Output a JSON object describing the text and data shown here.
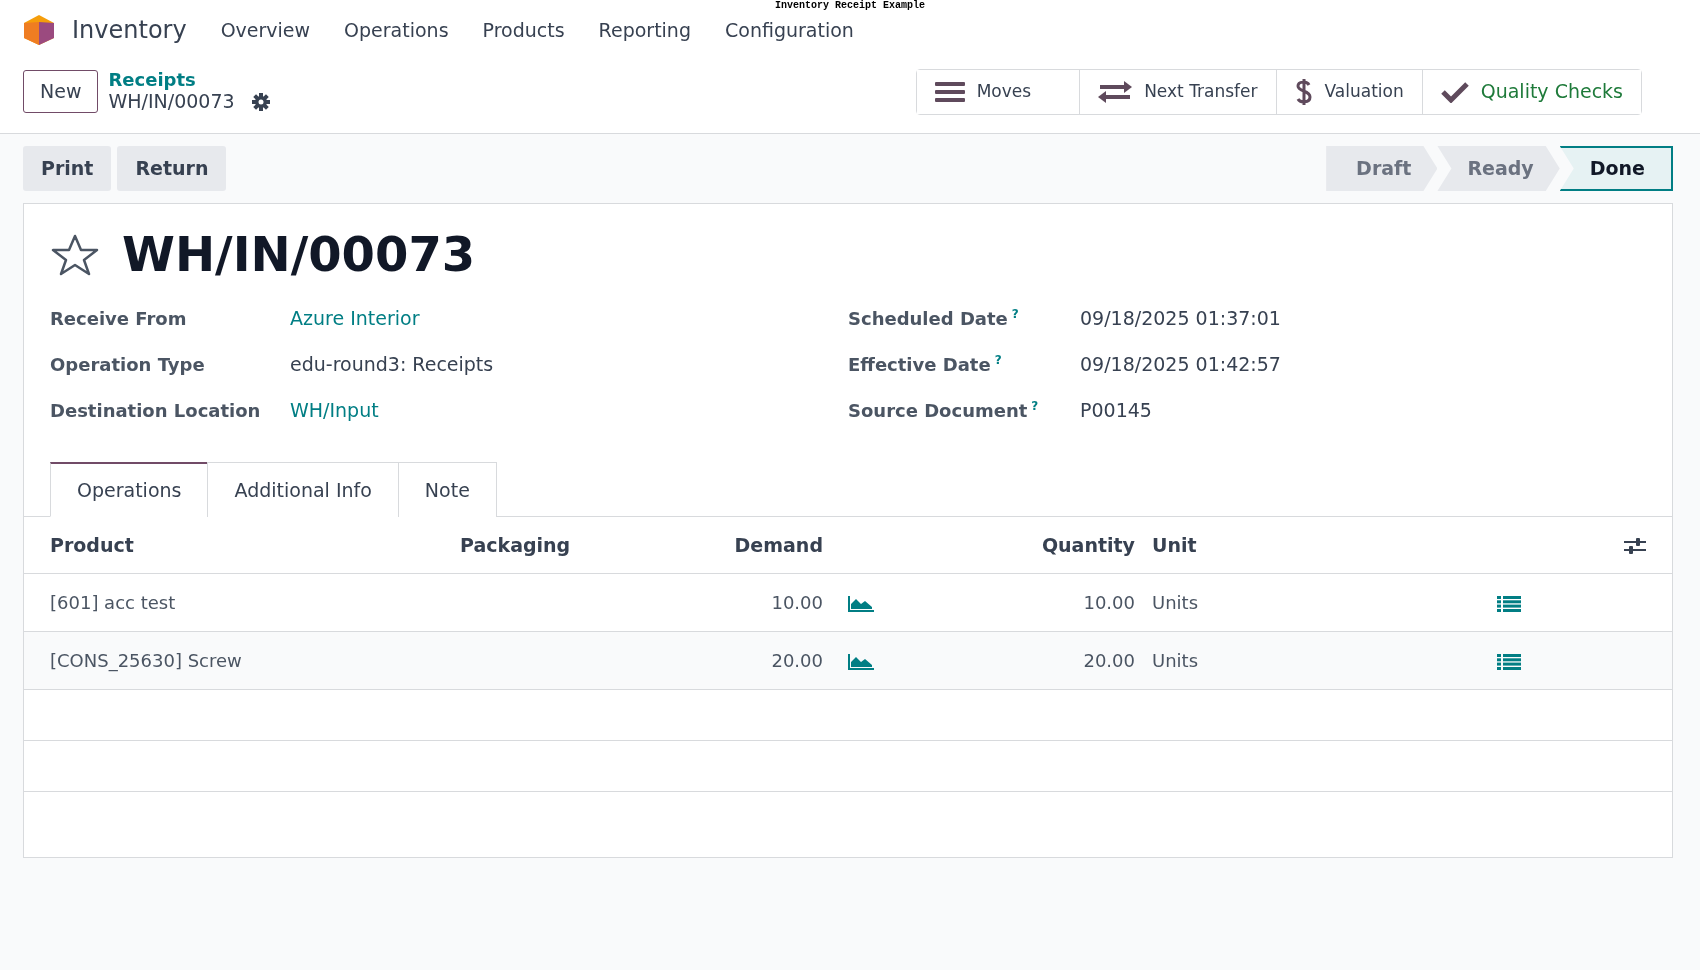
{
  "caption": "Inventory Receipt Example",
  "app": {
    "name": "Inventory",
    "menu": [
      "Overview",
      "Operations",
      "Products",
      "Reporting",
      "Configuration"
    ]
  },
  "control_panel": {
    "new_button": "New",
    "breadcrumb": "Receipts",
    "record": "WH/IN/00073",
    "smart_buttons": [
      {
        "kind": "moves",
        "label": "Moves"
      },
      {
        "kind": "transfer",
        "label": "Next Transfer"
      },
      {
        "kind": "valuation",
        "label": "Valuation"
      },
      {
        "kind": "quality",
        "label": "Quality Checks"
      }
    ]
  },
  "actions": [
    "Print",
    "Return"
  ],
  "stages": [
    {
      "label": "Draft",
      "selected": false
    },
    {
      "label": "Ready",
      "selected": false
    },
    {
      "label": "Done",
      "selected": true
    }
  ],
  "form": {
    "title": "WH/IN/00073",
    "starred": false,
    "left_fields": [
      {
        "label": "Receive From",
        "value": "Azure Interior",
        "link": true
      },
      {
        "label": "Operation Type",
        "value": "edu-round3: Receipts",
        "link": false
      },
      {
        "label": "Destination Location",
        "value": "WH/Input",
        "link": true
      }
    ],
    "right_fields": [
      {
        "label": "Scheduled Date",
        "help": "?",
        "value": "09/18/2025 01:37:01"
      },
      {
        "label": "Effective Date",
        "help": "?",
        "value": "09/18/2025 01:42:57"
      },
      {
        "label": "Source Document",
        "help": "?",
        "value": "P00145"
      }
    ],
    "tabs": [
      {
        "label": "Operations",
        "selected": true
      },
      {
        "label": "Additional Info",
        "selected": false
      },
      {
        "label": "Note",
        "selected": false
      }
    ],
    "table": {
      "columns": [
        "Product",
        "Packaging",
        "Demand",
        "Quantity",
        "Unit"
      ],
      "rows": [
        {
          "product": "[601] acc test",
          "demand": "10.00",
          "quantity": "10.00",
          "unit": "Units"
        },
        {
          "product": "[CONS_25630] Screw",
          "demand": "20.00",
          "quantity": "20.00",
          "unit": "Units"
        }
      ]
    }
  }
}
